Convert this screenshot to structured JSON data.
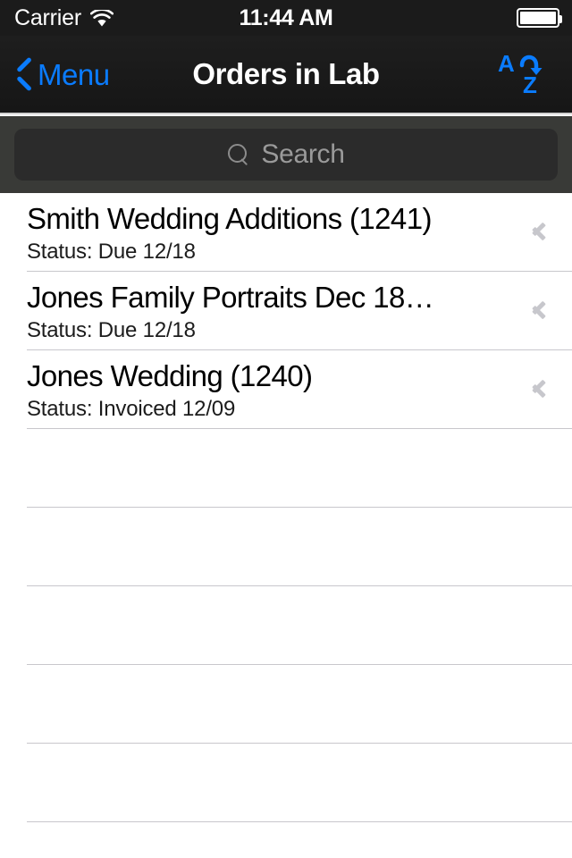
{
  "status_bar": {
    "carrier": "Carrier",
    "wifi_icon": "wifi-icon",
    "time": "11:44 AM",
    "battery_icon": "battery-icon",
    "battery_level_percent": 100
  },
  "nav_bar": {
    "back_icon": "chevron-left-icon",
    "back_label": "Menu",
    "title": "Orders in Lab",
    "sort_button": {
      "icon": "sort-alpha-asc-icon",
      "letter_top": "A",
      "letter_bottom": "Z"
    },
    "accent_color": "#0a7cff",
    "background_color": "#1b1b1b"
  },
  "search": {
    "icon": "search-icon",
    "placeholder": "Search",
    "value": ""
  },
  "list": {
    "chevron_icon": "chevron-right-icon",
    "rows": [
      {
        "title": "Smith Wedding Additions (1241)",
        "subtitle": "Status: Due 12/18"
      },
      {
        "title": "Jones Family Portraits Dec 18…",
        "subtitle": "Status: Due 12/18"
      },
      {
        "title": "Jones Wedding (1240)",
        "subtitle": "Status: Invoiced 12/09"
      }
    ],
    "empty_row_count": 5
  }
}
